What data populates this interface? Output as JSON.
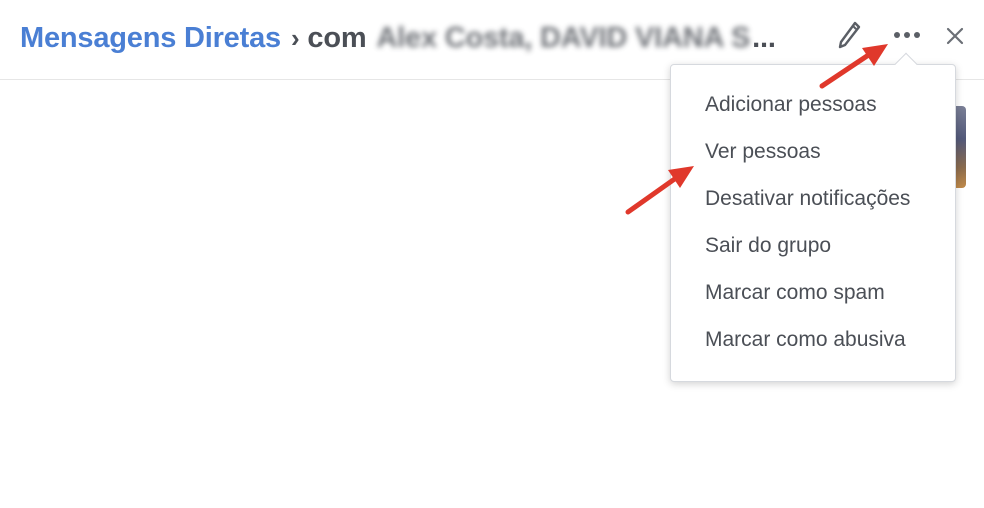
{
  "header": {
    "breadcrumb_link": "Mensagens Diretas",
    "separator": "›",
    "prefix": "com",
    "participants": "Alex Costa, DAVID VIANA S",
    "ellipsis": "..."
  },
  "icons": {
    "edit": "pencil-icon",
    "more": "more-options-icon",
    "close": "close-icon"
  },
  "menu": {
    "items": [
      "Adicionar pessoas",
      "Ver pessoas",
      "Desativar notificações",
      "Sair do grupo",
      "Marcar como spam",
      "Marcar como abusiva"
    ]
  },
  "colors": {
    "link": "#4a7fd4",
    "text": "#4b4f56",
    "annotation_arrow": "#e0382b"
  }
}
